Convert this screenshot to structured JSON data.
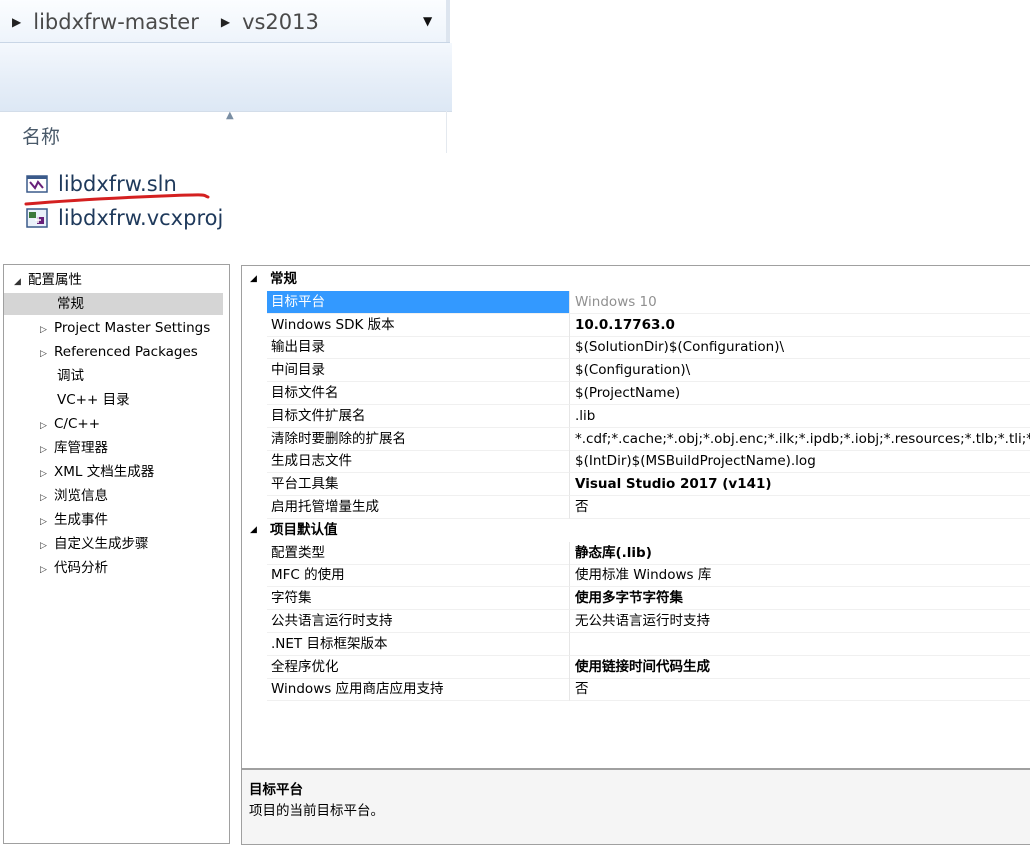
{
  "explorer": {
    "breadcrumb": [
      "libdxfrw-master",
      "vs2013"
    ],
    "column_header": "名称",
    "files": [
      {
        "name": "libdxfrw.sln",
        "icon": "solution-file-icon"
      },
      {
        "name": "libdxfrw.vcxproj",
        "icon": "vcxproj-file-icon"
      }
    ],
    "underline_color": "#d42020"
  },
  "tree": {
    "items": [
      {
        "label": "配置属性",
        "expander": "◢"
      },
      {
        "label": "常规"
      },
      {
        "label": "Project Master Settings",
        "expander": "▷"
      },
      {
        "label": "Referenced Packages",
        "expander": "▷"
      },
      {
        "label": "调试"
      },
      {
        "label": "VC++ 目录"
      },
      {
        "label": "C/C++",
        "expander": "▷"
      },
      {
        "label": "库管理器",
        "expander": "▷"
      },
      {
        "label": "XML 文档生成器",
        "expander": "▷"
      },
      {
        "label": "浏览信息",
        "expander": "▷"
      },
      {
        "label": "生成事件",
        "expander": "▷"
      },
      {
        "label": "自定义生成步骤",
        "expander": "▷"
      },
      {
        "label": "代码分析",
        "expander": "▷"
      }
    ],
    "selected": "常规"
  },
  "grid": {
    "categories": [
      {
        "name": "常规",
        "rows": [
          {
            "name": "目标平台",
            "value": "Windows 10",
            "style": "gray"
          },
          {
            "name": "Windows SDK 版本",
            "value": "10.0.17763.0",
            "style": "bold"
          },
          {
            "name": "输出目录",
            "value": "$(SolutionDir)$(Configuration)\\",
            "style": ""
          },
          {
            "name": "中间目录",
            "value": "$(Configuration)\\",
            "style": ""
          },
          {
            "name": "目标文件名",
            "value": "$(ProjectName)",
            "style": ""
          },
          {
            "name": "目标文件扩展名",
            "value": ".lib",
            "style": ""
          },
          {
            "name": "清除时要删除的扩展名",
            "value": "*.cdf;*.cache;*.obj;*.obj.enc;*.ilk;*.ipdb;*.iobj;*.resources;*.tlb;*.tli;*.t",
            "style": ""
          },
          {
            "name": "生成日志文件",
            "value": "$(IntDir)$(MSBuildProjectName).log",
            "style": ""
          },
          {
            "name": "平台工具集",
            "value": "Visual Studio 2017 (v141)",
            "style": "bold"
          },
          {
            "name": "启用托管增量生成",
            "value": "否",
            "style": ""
          }
        ]
      },
      {
        "name": "项目默认值",
        "rows": [
          {
            "name": "配置类型",
            "value": "静态库(.lib)",
            "style": "bold"
          },
          {
            "name": "MFC 的使用",
            "value": "使用标准 Windows 库",
            "style": ""
          },
          {
            "name": "字符集",
            "value": "使用多字节字符集",
            "style": "bold"
          },
          {
            "name": "公共语言运行时支持",
            "value": "无公共语言运行时支持",
            "style": ""
          },
          {
            "name": ".NET 目标框架版本",
            "value": "",
            "style": ""
          },
          {
            "name": "全程序优化",
            "value": "使用链接时间代码生成",
            "style": "bold"
          },
          {
            "name": "Windows 应用商店应用支持",
            "value": "否",
            "style": ""
          }
        ]
      }
    ],
    "selected": "目标平台",
    "selection_color": "#3399ff",
    "category_expander": "◢"
  },
  "description": {
    "title": "目标平台",
    "text": "项目的当前目标平台。"
  }
}
